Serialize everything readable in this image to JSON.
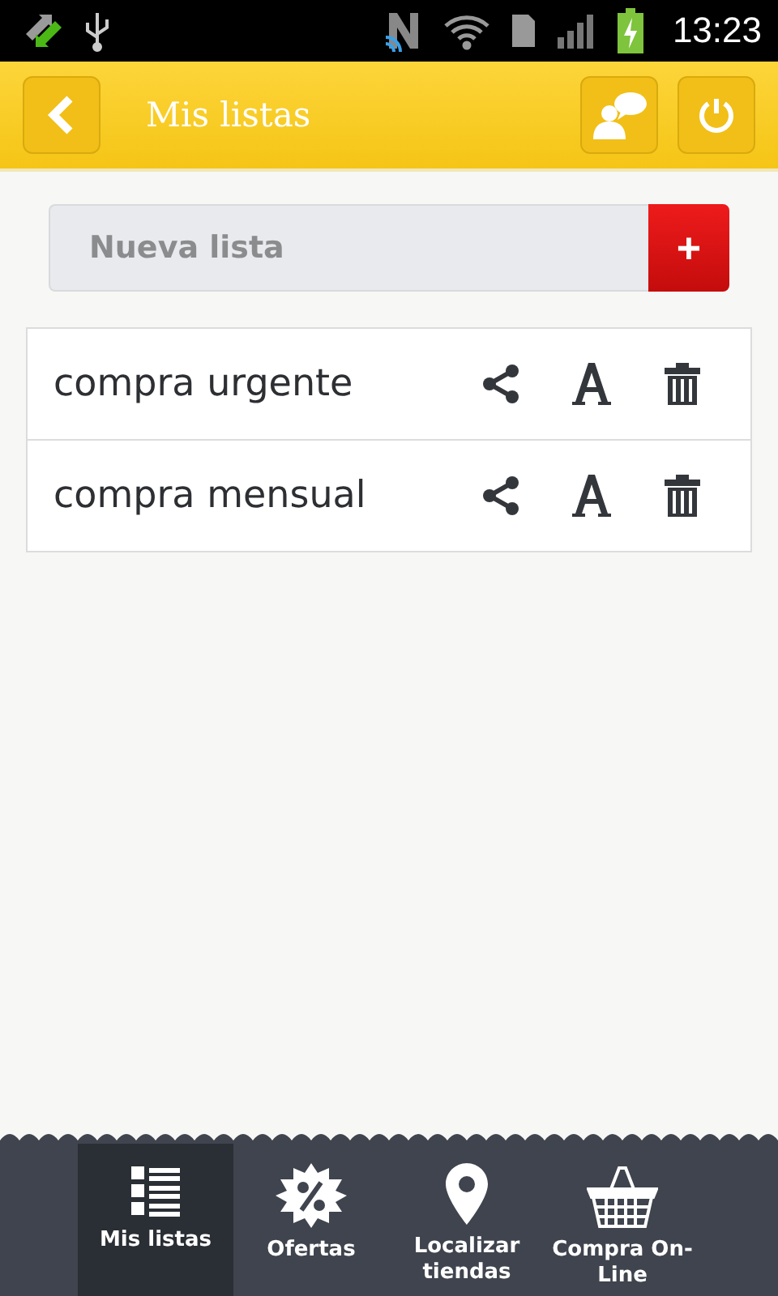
{
  "status_bar": {
    "time": "13:23"
  },
  "header": {
    "title": "Mis listas"
  },
  "new_list": {
    "placeholder": "Nueva lista",
    "add_button": "+"
  },
  "lists": [
    {
      "name": "compra urgente"
    },
    {
      "name": "compra mensual"
    }
  ],
  "tabs": [
    {
      "label": "Mis listas",
      "kind": "list",
      "selected": true
    },
    {
      "label": "Ofertas",
      "kind": "offer",
      "selected": false
    },
    {
      "label": "Localizar tiendas",
      "kind": "pin",
      "selected": false
    },
    {
      "label": "Compra On-Line",
      "kind": "basket",
      "selected": false
    }
  ]
}
